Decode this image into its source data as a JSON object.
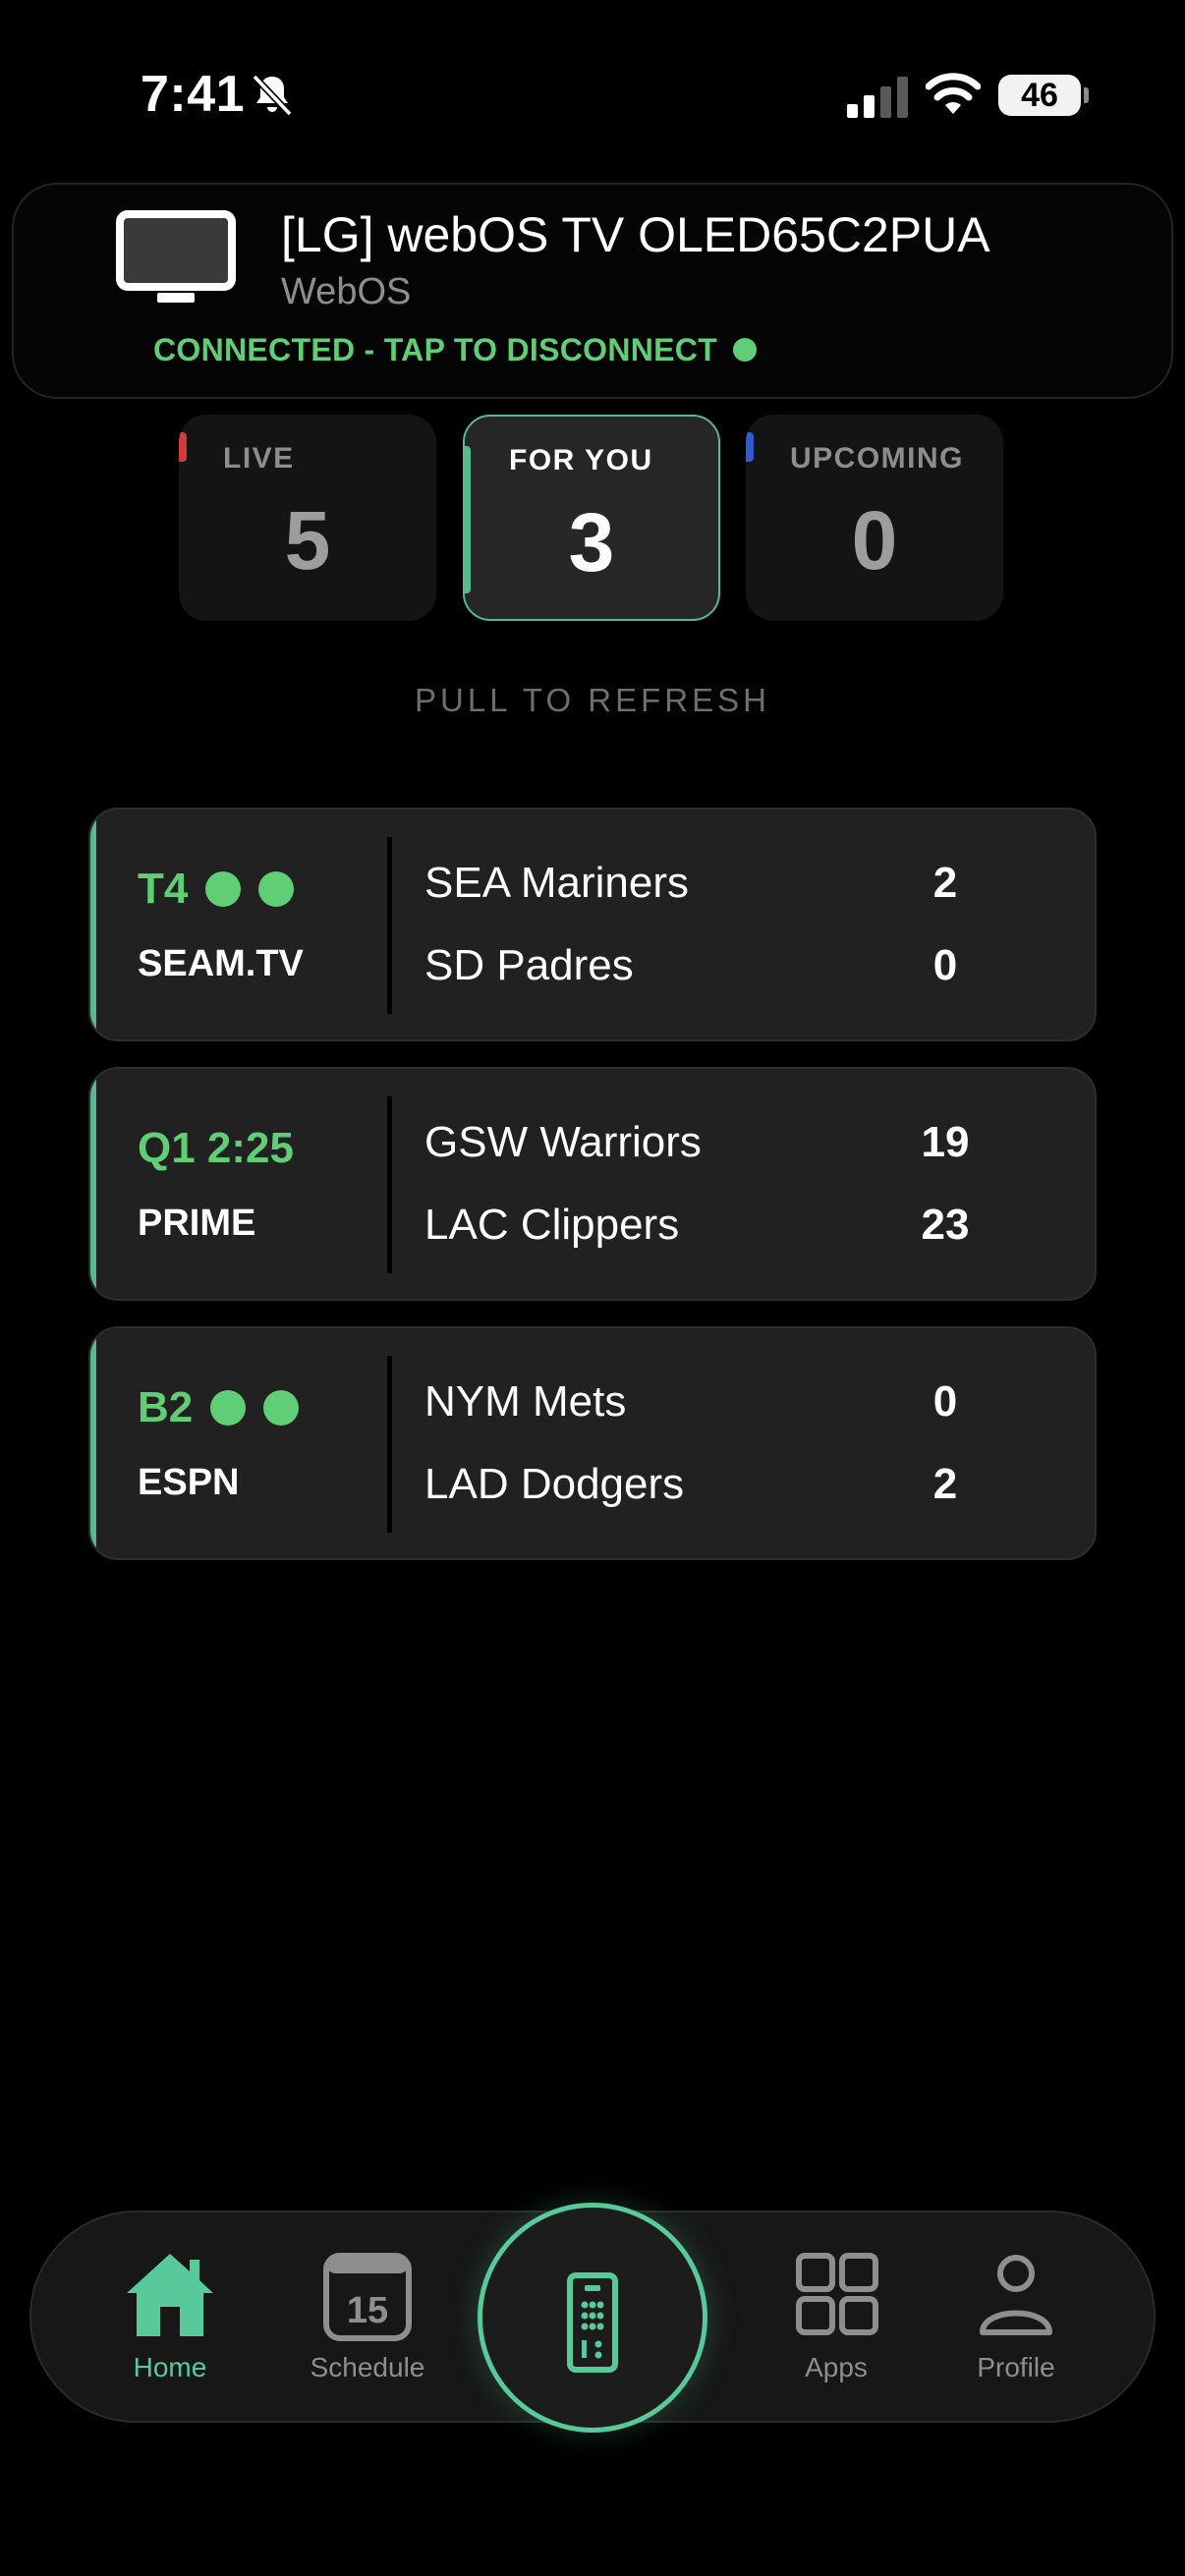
{
  "status_bar": {
    "time": "7:41",
    "battery": "46"
  },
  "device": {
    "name": "[LG] webOS TV OLED65C2PUA",
    "os": "WebOS",
    "connection": "CONNECTED - TAP TO DISCONNECT",
    "connected_color": "#5fce74"
  },
  "categories": [
    {
      "label": "LIVE",
      "count": "5",
      "accent": "#d23b3b"
    },
    {
      "label": "FOR YOU",
      "count": "3",
      "accent": "#58b98e",
      "selected": true
    },
    {
      "label": "UPCOMING",
      "count": "0",
      "accent": "#2f5bd3"
    }
  ],
  "pull_hint": "PULL TO REFRESH",
  "games": [
    {
      "status": "T4",
      "bases_icon": "base-runner-dots",
      "network": "SEAM.TV",
      "teams": [
        {
          "name": "SEA Mariners",
          "score": "2"
        },
        {
          "name": "SD Padres",
          "score": "0"
        }
      ]
    },
    {
      "status": "Q1 2:25",
      "network": "PRIME",
      "teams": [
        {
          "name": "GSW Warriors",
          "score": "19"
        },
        {
          "name": "LAC Clippers",
          "score": "23"
        }
      ]
    },
    {
      "status": "B2",
      "bases_icon": "base-runner-dots",
      "network": "ESPN",
      "teams": [
        {
          "name": "NYM Mets",
          "score": "0"
        },
        {
          "name": "LAD Dodgers",
          "score": "2"
        }
      ]
    }
  ],
  "tabbar": {
    "home": "Home",
    "schedule": "Schedule",
    "schedule_day": "15",
    "apps": "Apps",
    "profile": "Profile",
    "center_icon": "remote-icon",
    "accent": "#58c99a"
  }
}
